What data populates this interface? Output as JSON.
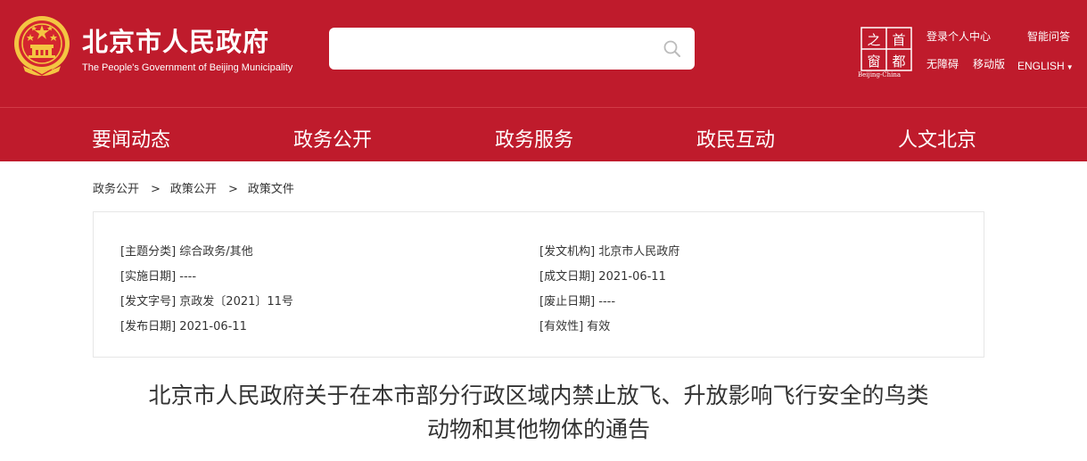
{
  "header": {
    "title_cn": "北京市人民政府",
    "title_en": "The People's Government of Beijing Municipality",
    "search": {
      "placeholder": ""
    },
    "capital_logo": {
      "chars": [
        "之",
        "首",
        "窗",
        "都"
      ],
      "subtitle": "Beijing-China"
    },
    "links": {
      "login": "登录个人中心",
      "smart_qa": "智能问答",
      "accessibility": "无障碍",
      "mobile": "移动版",
      "english": "ENGLISH"
    }
  },
  "nav": [
    "要闻动态",
    "政务公开",
    "政务服务",
    "政民互动",
    "人文北京"
  ],
  "breadcrumb": [
    "政务公开",
    "政策公开",
    "政策文件"
  ],
  "breadcrumb_separator": ">",
  "meta": {
    "left": [
      {
        "label": "[主题分类]",
        "value": "综合政务/其他"
      },
      {
        "label": "[实施日期]",
        "value": "----"
      },
      {
        "label": "[发文字号]",
        "value": "京政发〔2021〕11号"
      },
      {
        "label": "[发布日期]",
        "value": "2021-06-11"
      }
    ],
    "right": [
      {
        "label": "[发文机构]",
        "value": "北京市人民政府"
      },
      {
        "label": "[成文日期]",
        "value": "2021-06-11"
      },
      {
        "label": "[废止日期]",
        "value": "----"
      },
      {
        "label": "[有效性]",
        "value": "有效"
      }
    ]
  },
  "article": {
    "title_line1": "北京市人民政府关于在本市部分行政区域内禁止放飞、升放影响飞行安全的鸟类",
    "title_line2": "动物和其他物体的通告"
  },
  "colors": {
    "brand_red": "#bf1b2c",
    "emblem_gold": "#f4c542",
    "text": "#333333",
    "border": "#e6e6e6"
  }
}
